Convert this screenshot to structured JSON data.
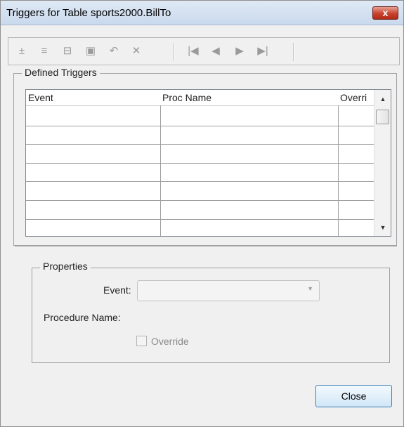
{
  "window": {
    "title": "Triggers for Table sports2000.BillTo",
    "close_glyph": "x"
  },
  "toolbar": {
    "buttons": [
      {
        "icon": "add-trigger-icon",
        "glyph": "±"
      },
      {
        "icon": "insert-row-icon",
        "glyph": "≡"
      },
      {
        "icon": "copy-row-icon",
        "glyph": "⊟"
      },
      {
        "icon": "save-icon",
        "glyph": "▣"
      },
      {
        "icon": "undo-icon",
        "glyph": "↶"
      },
      {
        "icon": "delete-icon",
        "glyph": "✕"
      },
      {
        "icon": "first-record-icon",
        "glyph": "|◀"
      },
      {
        "icon": "previous-record-icon",
        "glyph": "◀"
      },
      {
        "icon": "next-record-icon",
        "glyph": "▶"
      },
      {
        "icon": "last-record-icon",
        "glyph": "▶|"
      }
    ]
  },
  "defined_triggers": {
    "legend": "Defined Triggers",
    "columns": [
      "Event",
      "Proc Name",
      "Overri"
    ],
    "rows": [],
    "scroll_up": "▲",
    "scroll_down": "▼"
  },
  "properties": {
    "legend": "Properties",
    "event_label": "Event:",
    "event_value": "",
    "procedure_name_label": "Procedure Name:",
    "override_label": "Override",
    "override_checked": false
  },
  "buttons": {
    "close_label": "Close"
  }
}
